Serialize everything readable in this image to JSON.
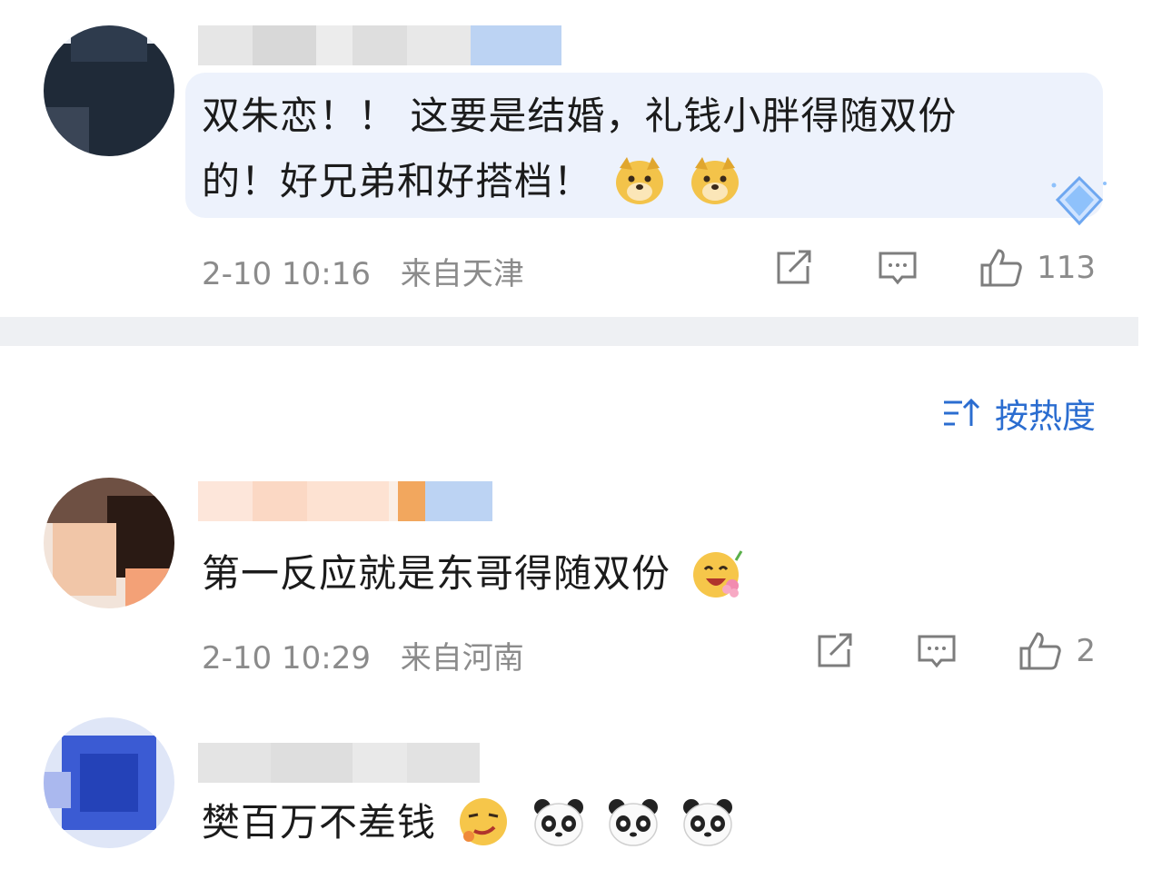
{
  "comments": [
    {
      "text_line1": "双朱恋！！ 这要是结婚，礼钱小胖得随双份",
      "text_line2": "的！好兄弟和好搭档！",
      "emojis": [
        "doge-emoji",
        "doge-emoji"
      ],
      "time": "2-10 10:16",
      "location": "来自天津",
      "likes": "113"
    },
    {
      "text": "第一反应就是东哥得随双份",
      "emojis": [
        "flower-laugh-emoji"
      ],
      "time": "2-10 10:29",
      "location": "来自河南",
      "likes": "2"
    },
    {
      "text": "樊百万不差钱",
      "emojis": [
        "smirk-emoji",
        "panda-emoji",
        "panda-emoji",
        "panda-emoji"
      ]
    }
  ],
  "sort": {
    "label": "按热度"
  },
  "colors": {
    "accent": "#2b6dd0",
    "bubble": "#edf2fc",
    "divider": "#eef0f3",
    "meta": "#8b8b8b"
  }
}
